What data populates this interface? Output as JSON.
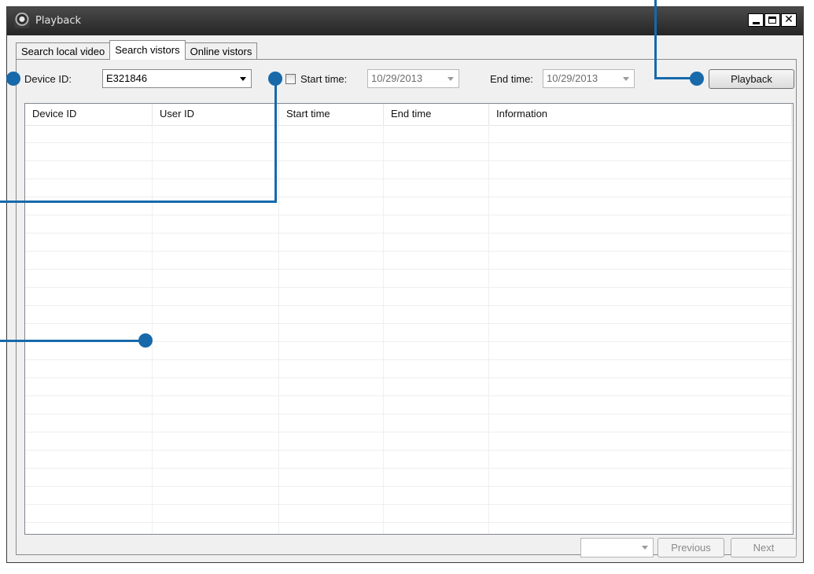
{
  "window": {
    "title": "Playback",
    "icon": "app-camera-icon"
  },
  "window_controls": {
    "minimize": "minimize-icon",
    "maximize": "maximize-icon",
    "close": "close-icon",
    "close_glyph": "✕"
  },
  "tabs": [
    {
      "label": "Search local video",
      "active": false
    },
    {
      "label": "Search vistors",
      "active": true
    },
    {
      "label": "Online vistors",
      "active": false
    }
  ],
  "filters": {
    "device_id_label": "Device ID:",
    "device_id_value": "E321846",
    "start_time_label": "Start time:",
    "start_time_checked": false,
    "start_time_value": "10/29/2013",
    "end_time_label": "End time:",
    "end_time_value": "10/29/2013"
  },
  "buttons": {
    "playback": "Playback",
    "previous": "Previous",
    "next": "Next"
  },
  "pagination": {
    "page_value": ""
  },
  "table": {
    "columns": [
      "Device ID",
      "User ID",
      "Start time",
      "End time",
      "Information"
    ],
    "rows": []
  },
  "colors": {
    "callout": "#1769aa",
    "titlebar": "#2b2b2b",
    "window_bg": "#f0f0f0"
  }
}
